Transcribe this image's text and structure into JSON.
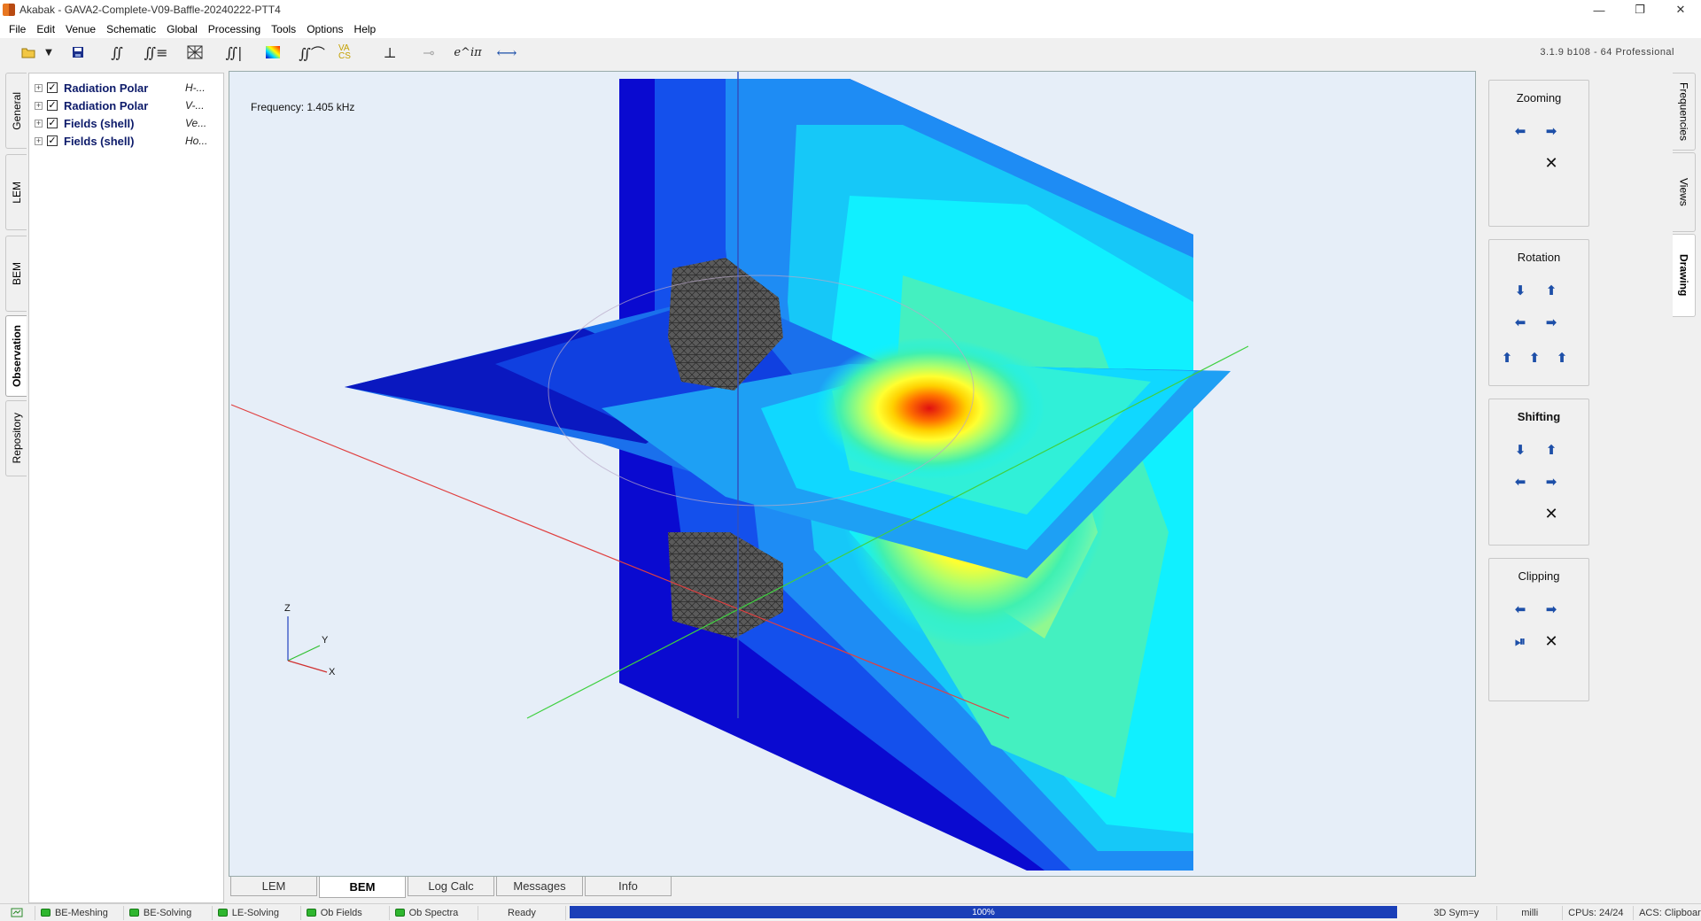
{
  "window": {
    "title": "Akabak - GAVA2-Complete-V09-Baffle-20240222-PTT4",
    "controls": [
      "—",
      "❐",
      "✕"
    ]
  },
  "menu": [
    "File",
    "Edit",
    "Venue",
    "Schematic",
    "Global",
    "Processing",
    "Tools",
    "Options",
    "Help"
  ],
  "toolbar": {
    "buttons": [
      "open-folder-icon",
      "dropdown-arrow-icon",
      "save-icon",
      "integral-icon",
      "integral-list-icon",
      "mesh-icon",
      "integral-bars-icon",
      "color-map-icon",
      "integral-curve-icon",
      "vacs-icon",
      "balance-icon",
      "dots-icon",
      "exponential-icon",
      "double-arrow-icon"
    ],
    "vacs_text": "VA CS",
    "exp_text": "e^iπ",
    "version": "3.1.9 b108 - 64 Professional"
  },
  "left_tabs": [
    "General",
    "LEM",
    "BEM",
    "Observation",
    "Repository"
  ],
  "left_tabs_active": "Observation",
  "tree": [
    {
      "label": "Radiation Polar",
      "sub": "H-...",
      "checked": true
    },
    {
      "label": "Radiation Polar",
      "sub": "V-...",
      "checked": true
    },
    {
      "label": "Fields (shell)",
      "sub": "Ve...",
      "checked": true
    },
    {
      "label": "Fields (shell)",
      "sub": "Ho...",
      "checked": true
    }
  ],
  "viewport": {
    "frequency": "Frequency: 1.405 kHz",
    "axes": {
      "z": "Z",
      "y": "Y",
      "x": "X"
    }
  },
  "bottom_tabs": [
    "LEM",
    "BEM",
    "Log Calc",
    "Messages",
    "Info"
  ],
  "bottom_tabs_active": "BEM",
  "controls": {
    "zooming": {
      "title": "Zooming"
    },
    "rotation": {
      "title": "Rotation"
    },
    "shifting": {
      "title": "Shifting"
    },
    "clipping": {
      "title": "Clipping"
    }
  },
  "right_tabs": [
    "Frequencies",
    "Views",
    "Drawing"
  ],
  "right_tabs_active": "Drawing",
  "status": {
    "items": [
      {
        "label": "BE-Meshing",
        "color": "#2fb62f"
      },
      {
        "label": "BE-Solving",
        "color": "#2fb62f"
      },
      {
        "label": "LE-Solving",
        "color": "#2fb62f"
      },
      {
        "label": "Ob Fields",
        "color": "#2fb62f"
      },
      {
        "label": "Ob Spectra",
        "color": "#2fb62f"
      }
    ],
    "ready": "Ready",
    "progress": "100%",
    "progress_value": 1.0,
    "sym": "3D Sym=y",
    "unit": "milli",
    "cpus": "CPUs: 24/24",
    "acs": "ACS: Clipboard"
  }
}
